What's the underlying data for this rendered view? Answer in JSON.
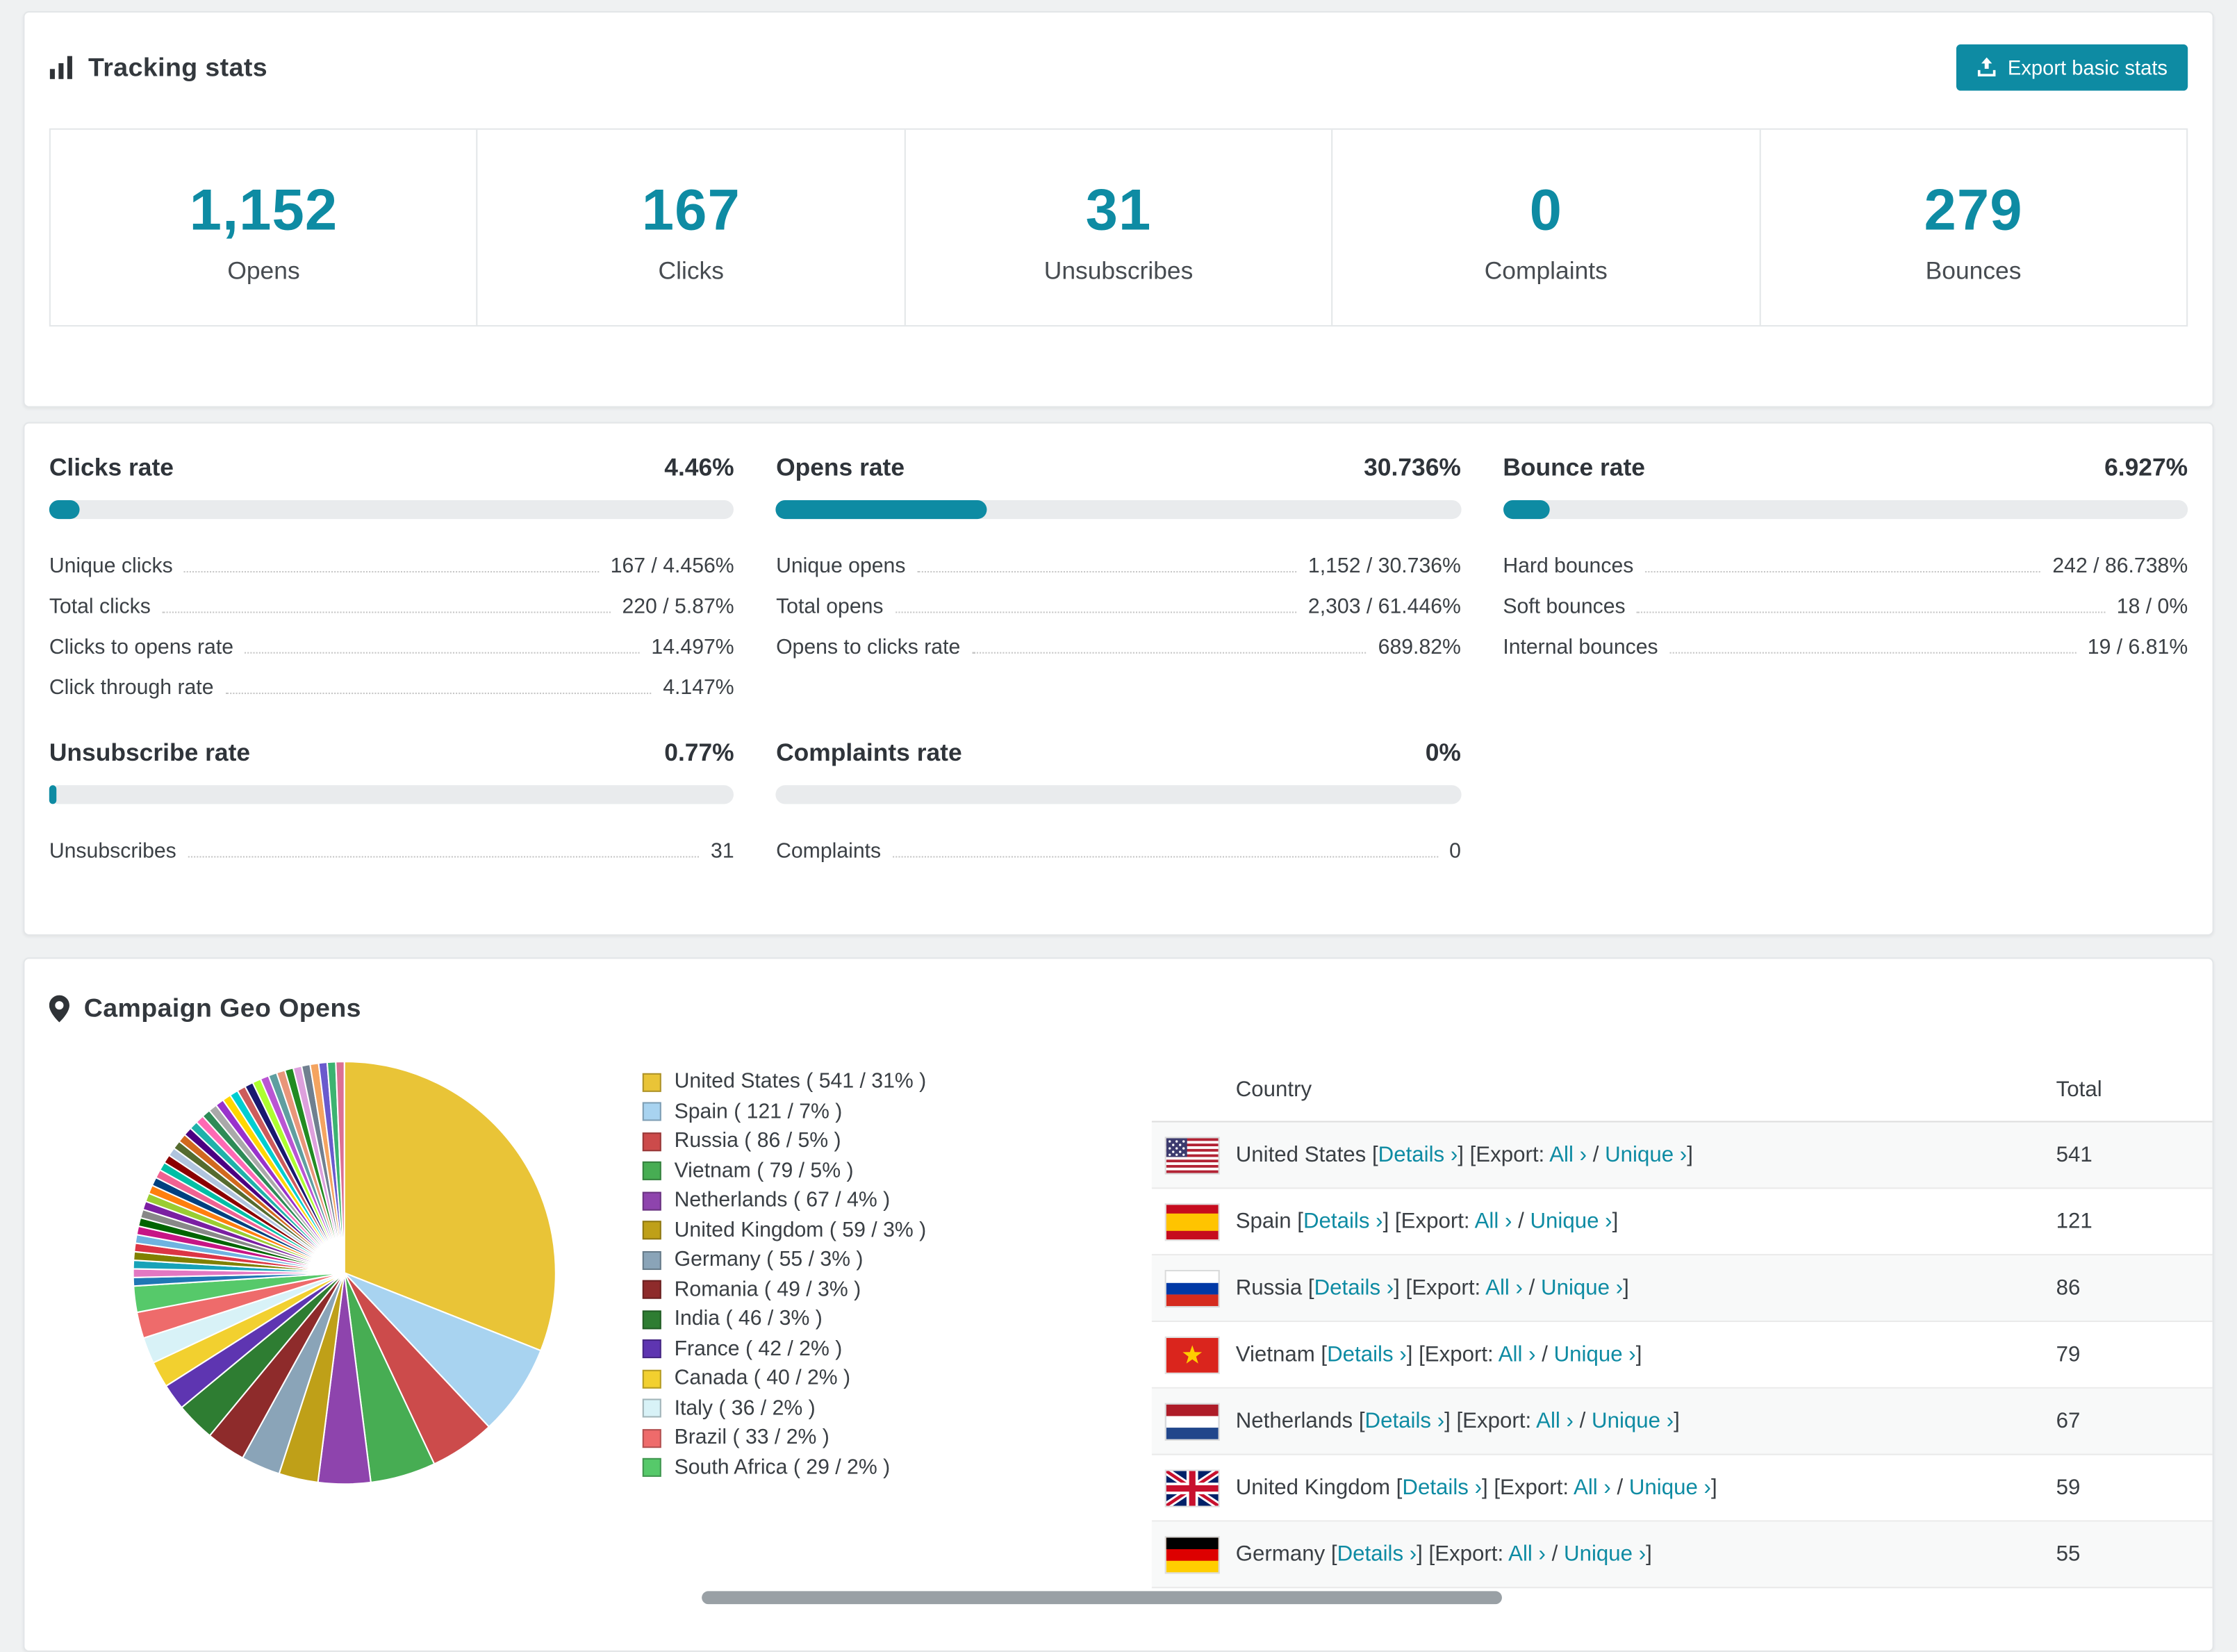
{
  "colors": {
    "accent": "#0e8ba3"
  },
  "tracking": {
    "title": "Tracking stats",
    "export_button": "Export basic stats",
    "stats": [
      {
        "value": "1,152",
        "label": "Opens"
      },
      {
        "value": "167",
        "label": "Clicks"
      },
      {
        "value": "31",
        "label": "Unsubscribes"
      },
      {
        "value": "0",
        "label": "Complaints"
      },
      {
        "value": "279",
        "label": "Bounces"
      }
    ]
  },
  "rates": [
    {
      "title": "Clicks rate",
      "value": "4.46%",
      "percent": 4.46,
      "rows": [
        {
          "label": "Unique clicks",
          "value": "167 / 4.456%"
        },
        {
          "label": "Total clicks",
          "value": "220 / 5.87%"
        },
        {
          "label": "Clicks to opens rate",
          "value": "14.497%"
        },
        {
          "label": "Click through rate",
          "value": "4.147%"
        }
      ]
    },
    {
      "title": "Opens rate",
      "value": "30.736%",
      "percent": 30.736,
      "rows": [
        {
          "label": "Unique opens",
          "value": "1,152 / 30.736%"
        },
        {
          "label": "Total opens",
          "value": "2,303 / 61.446%"
        },
        {
          "label": "Opens to clicks rate",
          "value": "689.82%"
        }
      ]
    },
    {
      "title": "Bounce rate",
      "value": "6.927%",
      "percent": 6.927,
      "rows": [
        {
          "label": "Hard bounces",
          "value": "242 / 86.738%"
        },
        {
          "label": "Soft bounces",
          "value": "18 / 0%"
        },
        {
          "label": "Internal bounces",
          "value": "19 / 6.81%"
        }
      ]
    },
    {
      "title": "Unsubscribe rate",
      "value": "0.77%",
      "percent": 0.77,
      "rows": [
        {
          "label": "Unsubscribes",
          "value": "31"
        }
      ]
    },
    {
      "title": "Complaints rate",
      "value": "0%",
      "percent": 0,
      "rows": [
        {
          "label": "Complaints",
          "value": "0"
        }
      ]
    }
  ],
  "geo": {
    "title": "Campaign Geo Opens",
    "table_headers": {
      "country": "Country",
      "total": "Total"
    },
    "link_labels": {
      "details": "Details ›",
      "export": "Export:",
      "all": "All ›",
      "unique": "Unique ›"
    },
    "rows": [
      {
        "country": "United States",
        "total": "541",
        "flag": "us"
      },
      {
        "country": "Spain",
        "total": "121",
        "flag": "es"
      },
      {
        "country": "Russia",
        "total": "86",
        "flag": "ru"
      },
      {
        "country": "Vietnam",
        "total": "79",
        "flag": "vn"
      },
      {
        "country": "Netherlands",
        "total": "67",
        "flag": "nl"
      },
      {
        "country": "United Kingdom",
        "total": "59",
        "flag": "gb"
      },
      {
        "country": "Germany",
        "total": "55",
        "flag": "de"
      }
    ]
  },
  "chart_data": {
    "type": "pie",
    "title": "Campaign Geo Opens",
    "legend_position": "right",
    "slices": [
      {
        "label": "United States ( 541 / 31% )",
        "value": 541,
        "percent": 31,
        "color": "#e9c437"
      },
      {
        "label": "Spain ( 121 / 7% )",
        "value": 121,
        "percent": 7,
        "color": "#a8d3f0"
      },
      {
        "label": "Russia ( 86 / 5% )",
        "value": 86,
        "percent": 5,
        "color": "#cc4b4b"
      },
      {
        "label": "Vietnam ( 79 / 5% )",
        "value": 79,
        "percent": 5,
        "color": "#47ad53"
      },
      {
        "label": "Netherlands ( 67 / 4% )",
        "value": 67,
        "percent": 4,
        "color": "#8e44ad"
      },
      {
        "label": "United Kingdom ( 59 / 3% )",
        "value": 59,
        "percent": 3,
        "color": "#bfa018"
      },
      {
        "label": "Germany ( 55 / 3% )",
        "value": 55,
        "percent": 3,
        "color": "#8aa4b8"
      },
      {
        "label": "Romania ( 49 / 3% )",
        "value": 49,
        "percent": 3,
        "color": "#8e2b2b"
      },
      {
        "label": "India ( 46 / 3% )",
        "value": 46,
        "percent": 3,
        "color": "#2e7d32"
      },
      {
        "label": "France ( 42 / 2% )",
        "value": 42,
        "percent": 2,
        "color": "#5e35b1"
      },
      {
        "label": "Canada ( 40 / 2% )",
        "value": 40,
        "percent": 2,
        "color": "#f2d02f"
      },
      {
        "label": "Italy ( 36 / 2% )",
        "value": 36,
        "percent": 2,
        "color": "#d8f2f7"
      },
      {
        "label": "Brazil ( 33 / 2% )",
        "value": 33,
        "percent": 2,
        "color": "#ee6b6b"
      },
      {
        "label": "South Africa ( 29 / 2% )",
        "value": 29,
        "percent": 2,
        "color": "#56c96a"
      }
    ],
    "other_slices": {
      "percent_total": 26,
      "count": 40,
      "palette": [
        "#1f77b4",
        "#e377c2",
        "#17a2b8",
        "#808000",
        "#dc3545",
        "#6fb3e0",
        "#c71585",
        "#006400",
        "#888888",
        "#7b1fa2",
        "#9acd32",
        "#ff7f0e",
        "#004080",
        "#f06292",
        "#00bfa5",
        "#8b0000",
        "#b0c4de",
        "#556b2f",
        "#d2691e",
        "#4b0082",
        "#20b2aa",
        "#ff69b4",
        "#2e8b57",
        "#a9a9a9",
        "#9932cc",
        "#ffd700",
        "#00ced1",
        "#cd5c5c",
        "#191970",
        "#adff2f",
        "#ba55d3",
        "#5f9ea0",
        "#e9967a",
        "#228b22",
        "#dda0dd",
        "#708090",
        "#f4a460",
        "#6a5acd",
        "#3cb371",
        "#db7093"
      ]
    }
  }
}
